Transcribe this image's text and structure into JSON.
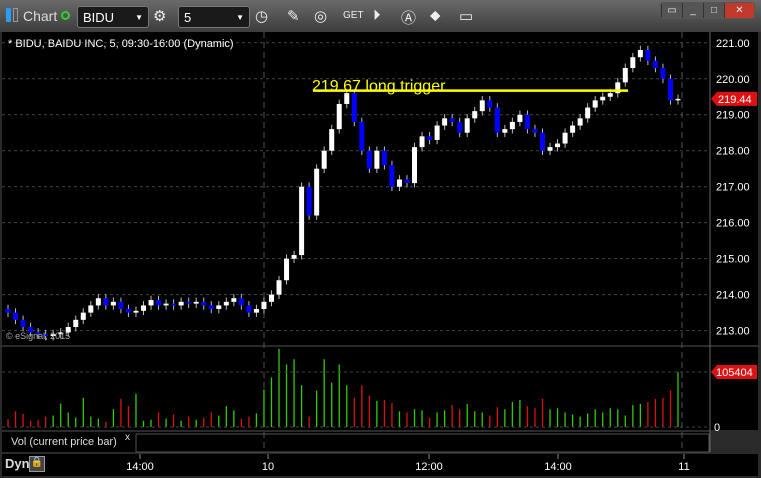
{
  "window": {
    "title": "Chart",
    "symbol": "BIDU",
    "interval": "5"
  },
  "legend": "* BIDU, BAIDU INC, 5, 09:30-16:00 (Dynamic)",
  "copyright": "© eSignal, 2015",
  "annotation": {
    "text": "219.67 long trigger",
    "price": 219.67
  },
  "current_price": "219.44",
  "volume_pane": {
    "label": "Vol (current price bar)",
    "close_label": "x",
    "last_volume": "105404",
    "zero_label": "0"
  },
  "bottom": {
    "dyn_label": "Dyn"
  },
  "colors": {
    "up": "#ffffff",
    "down": "#0000ff",
    "vol_up": "#33cc00",
    "vol_down": "#dd1111",
    "annotation": "#ffff00",
    "price_tag": "#dd1111"
  },
  "chart_data": {
    "type": "candlestick",
    "y_ticks": [
      "221.00",
      "220.00",
      "219.00",
      "218.00",
      "217.00",
      "216.00",
      "215.00",
      "214.00",
      "213.00"
    ],
    "ylim": [
      212.6,
      221.3
    ],
    "x_ticks": [
      "14:00",
      "10",
      "12:00",
      "14:00",
      "11"
    ],
    "closes": [
      213.5,
      213.3,
      213.1,
      212.95,
      212.9,
      212.85,
      212.9,
      212.95,
      213.1,
      213.3,
      213.5,
      213.7,
      213.9,
      213.7,
      213.8,
      213.6,
      213.5,
      213.55,
      213.7,
      213.85,
      213.7,
      213.75,
      213.7,
      213.8,
      213.75,
      213.8,
      213.7,
      213.6,
      213.7,
      213.8,
      213.9,
      213.7,
      213.5,
      213.6,
      213.8,
      214.0,
      214.4,
      215.0,
      215.1,
      217.0,
      216.2,
      217.5,
      218.0,
      218.6,
      219.3,
      219.6,
      218.8,
      218.0,
      217.5,
      218.0,
      217.6,
      217.0,
      217.2,
      217.1,
      218.1,
      218.4,
      218.3,
      218.7,
      218.9,
      218.8,
      218.5,
      218.9,
      219.1,
      219.4,
      219.2,
      218.5,
      218.6,
      218.8,
      219.0,
      218.6,
      218.5,
      218.0,
      218.1,
      218.2,
      218.5,
      218.7,
      218.9,
      219.2,
      219.4,
      219.5,
      219.6,
      219.9,
      220.3,
      220.6,
      220.8,
      220.5,
      220.3,
      220.0,
      219.4,
      219.44
    ],
    "volumes": [
      15000,
      30000,
      25000,
      12000,
      14000,
      20000,
      22000,
      45000,
      28000,
      18000,
      56000,
      20000,
      16000,
      10000,
      34000,
      54000,
      40000,
      64000,
      12000,
      14000,
      28000,
      16000,
      24000,
      12000,
      20000,
      14000,
      18000,
      28000,
      22000,
      40000,
      32000,
      16000,
      20000,
      26000,
      72000,
      95000,
      150000,
      120000,
      130000,
      80000,
      20000,
      70000,
      130000,
      85000,
      120000,
      80000,
      56000,
      80000,
      60000,
      50000,
      52000,
      46000,
      30000,
      28000,
      34000,
      32000,
      18000,
      28000,
      32000,
      42000,
      34000,
      44000,
      30000,
      28000,
      22000,
      38000,
      34000,
      48000,
      52000,
      40000,
      36000,
      54000,
      34000,
      36000,
      28000,
      24000,
      20000,
      26000,
      34000,
      28000,
      36000,
      34000,
      22000,
      42000,
      44000,
      48000,
      54000,
      56000,
      70000,
      105404
    ]
  }
}
